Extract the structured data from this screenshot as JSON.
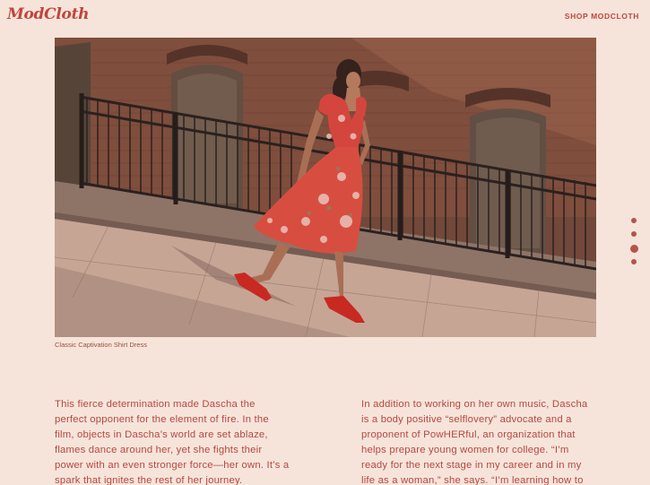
{
  "header": {
    "logo_text": "ModCloth",
    "shop_link_label": "SHOP MODCLOTH"
  },
  "hero": {
    "caption": "Classic Captivation Shirt Dress"
  },
  "carousel": {
    "slide_count": 4,
    "active_index": 2
  },
  "article": {
    "left_paragraph": "This fierce determination made Dascha the perfect opponent for the element of fire. In the film, objects in Dascha’s world are set ablaze, flames dance around her, yet she fights their power with an even stronger force—her own. It’s a spark that ignites the rest of her journey.",
    "right_paragraph": "In addition to working on her own music, Dascha is a body positive “selflovery” advocate and a proponent of PowHERful, an organization that helps prepare young women for college. “I’m ready for the next stage in my career and in my life as a woman,” she says. “I’m learning how to become confident and how to be able to accept"
  },
  "colors": {
    "background": "#f6e4da",
    "brand_red": "#c0453c",
    "body_text": "#b5483f"
  }
}
